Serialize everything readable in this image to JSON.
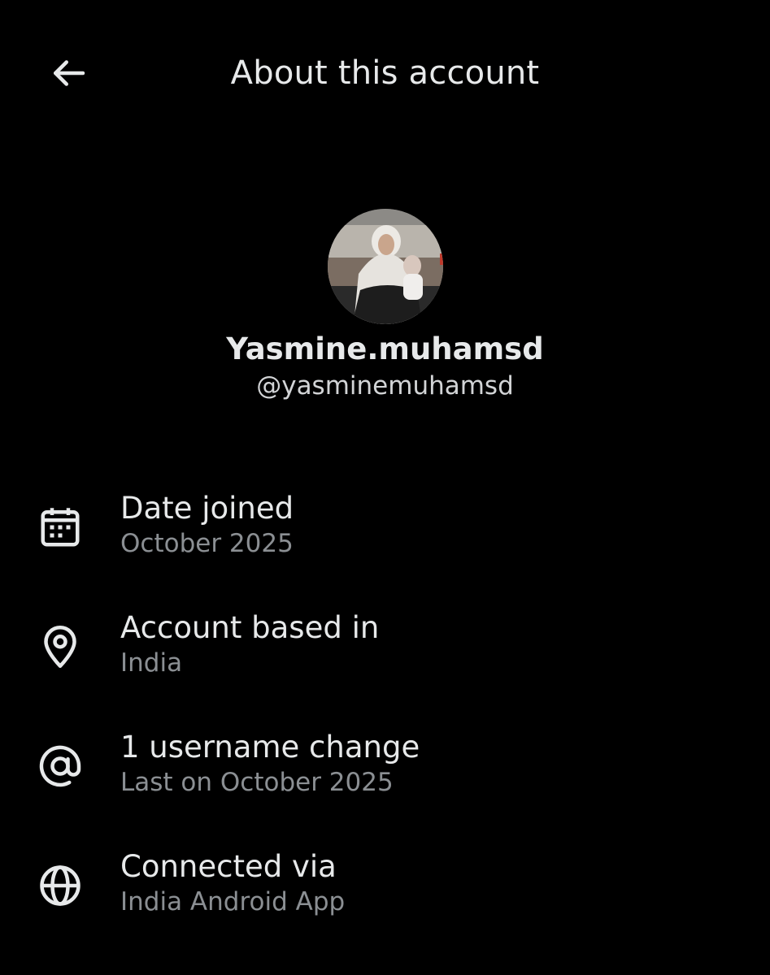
{
  "header": {
    "title": "About this account",
    "back_icon": "arrow-left-icon"
  },
  "profile": {
    "display_name": "Yasmine.muhamsd",
    "handle": "@yasminemuhamsd"
  },
  "details": [
    {
      "icon": "calendar-icon",
      "title": "Date joined",
      "value": "October 2025"
    },
    {
      "icon": "location-pin-icon",
      "title": "Account based in",
      "value": "India"
    },
    {
      "icon": "at-sign-icon",
      "title": "1 username change",
      "value": "Last on October 2025"
    },
    {
      "icon": "globe-icon",
      "title": "Connected via",
      "value": "India Android App"
    }
  ],
  "colors": {
    "background": "#000000",
    "primary_text": "#e7e9ea",
    "secondary_text": "#8b8f93"
  }
}
